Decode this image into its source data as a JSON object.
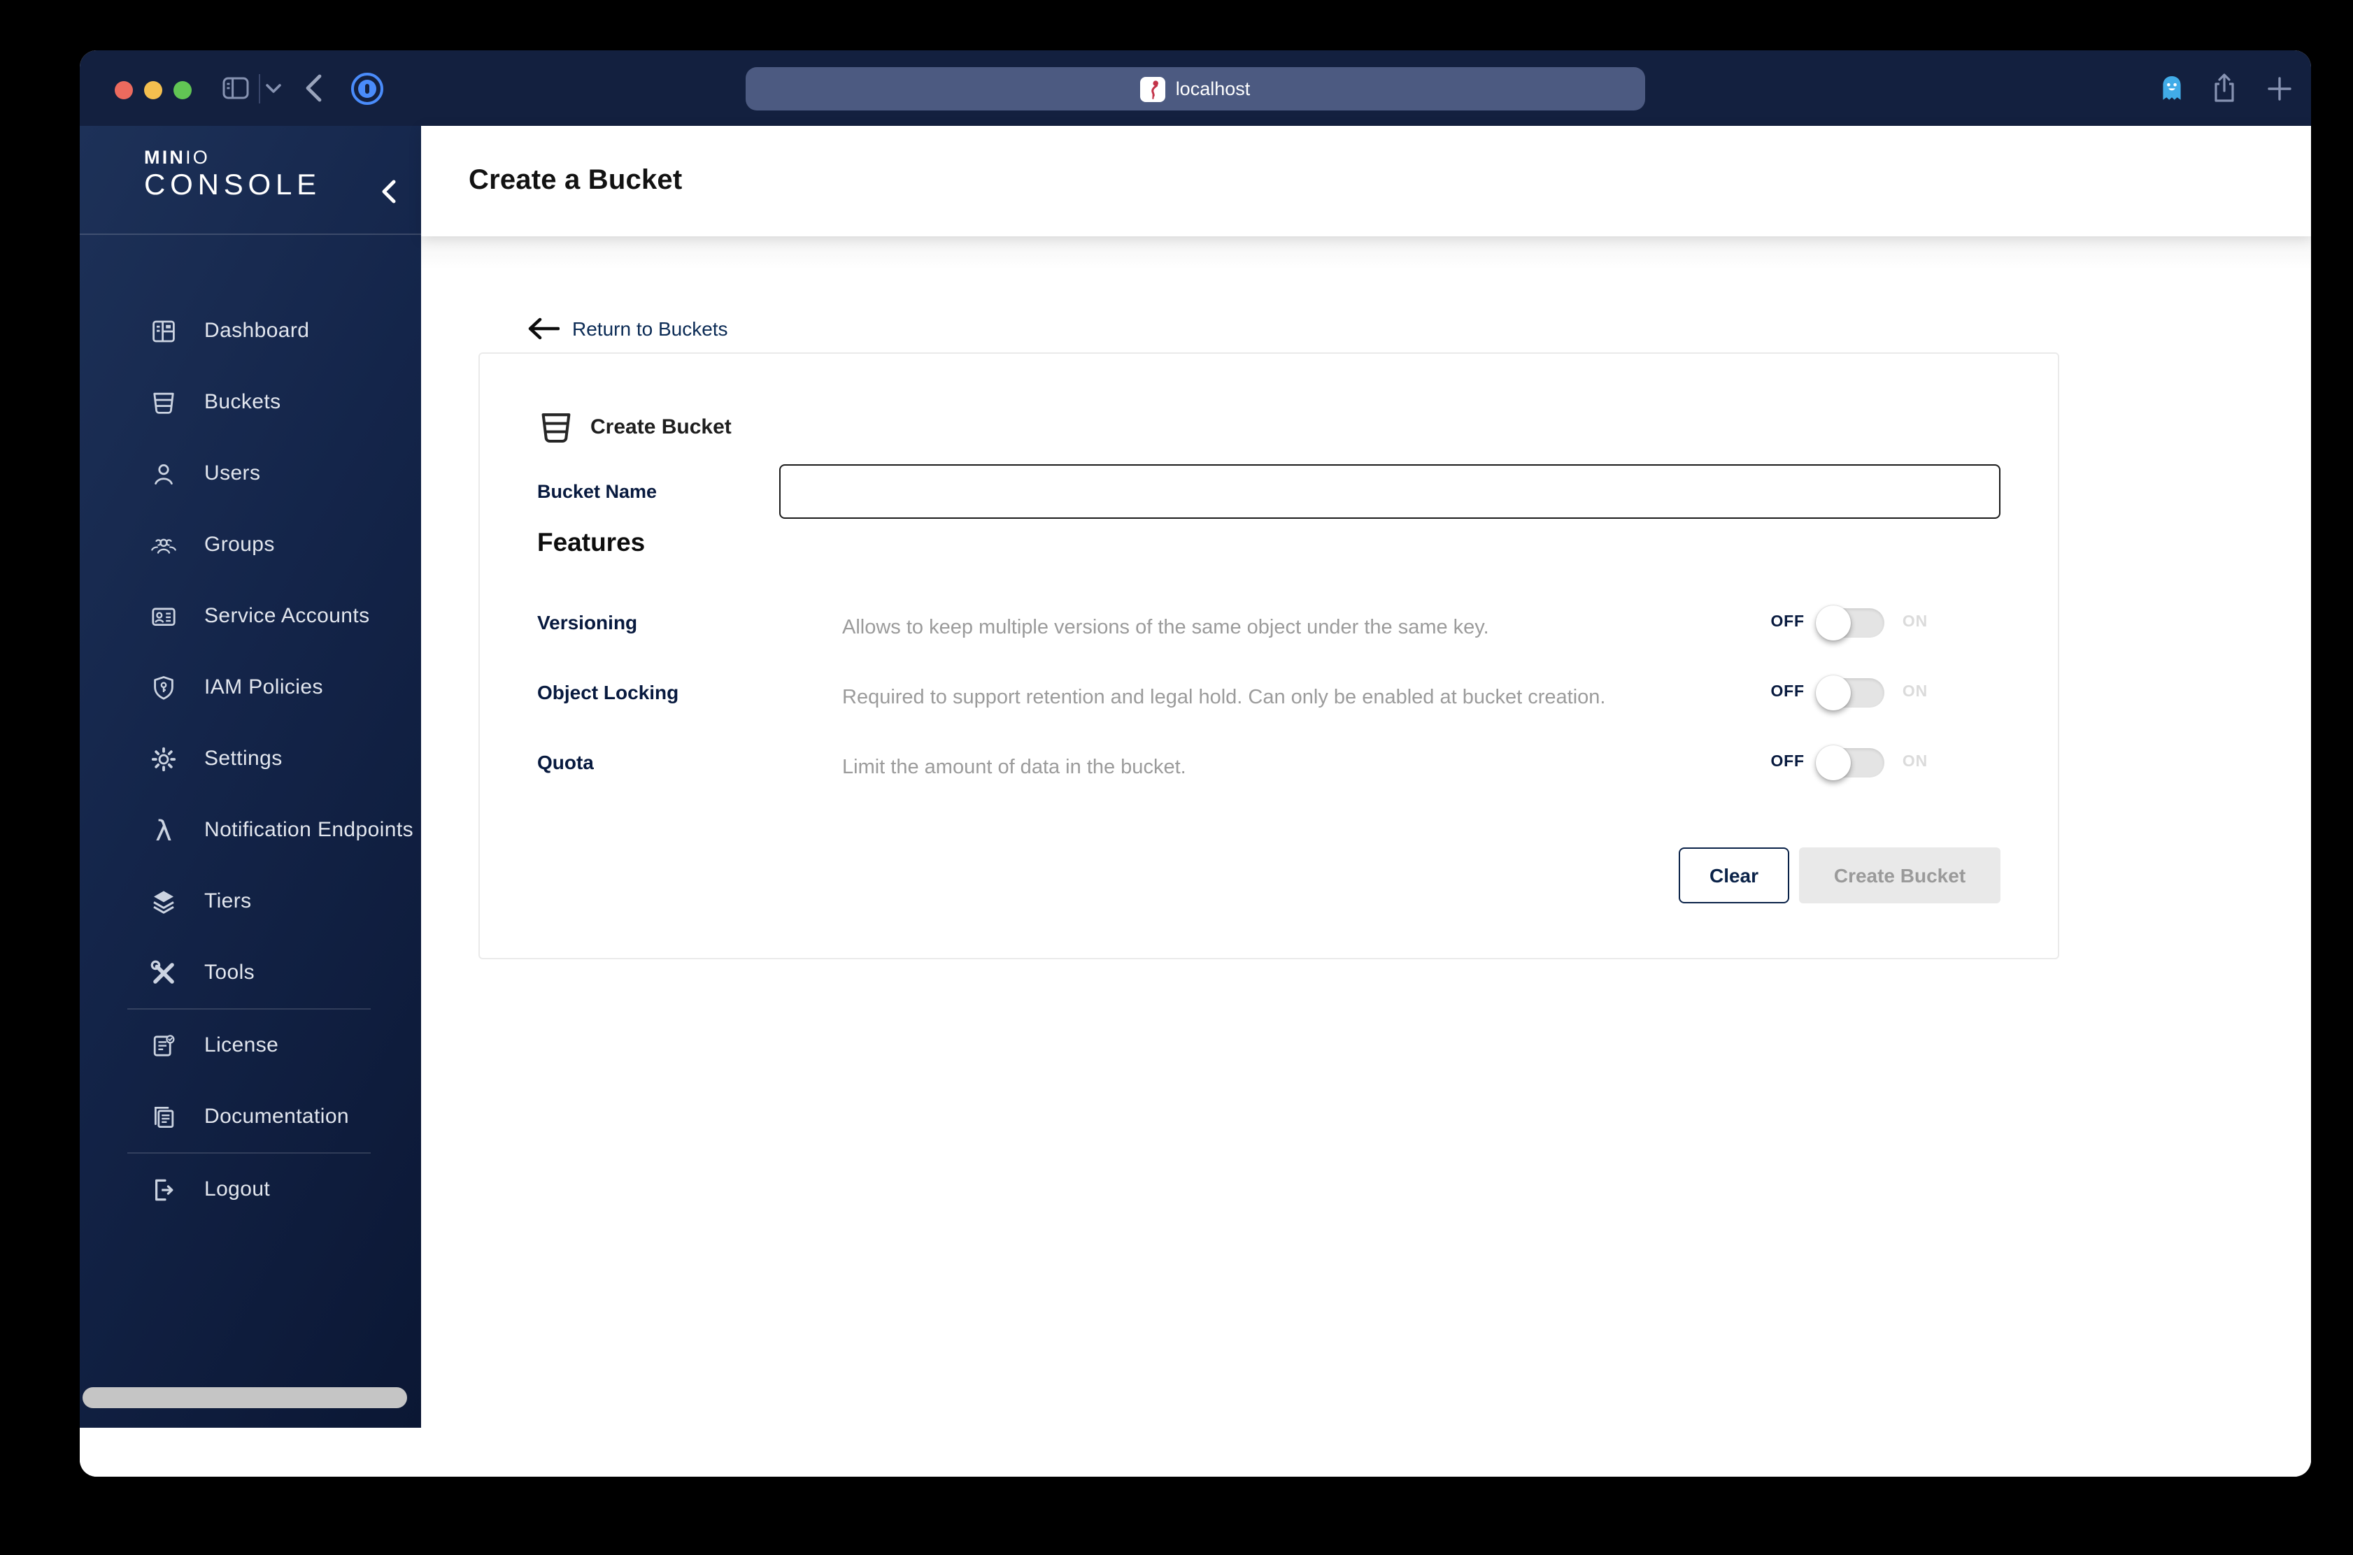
{
  "titlebar": {
    "url": "localhost"
  },
  "sidebar": {
    "logo": {
      "bold": "MIN",
      "light": "IO",
      "word": "CONSOLE"
    },
    "items": [
      {
        "label": "Dashboard",
        "icon": "dashboard-icon"
      },
      {
        "label": "Buckets",
        "icon": "bucket-icon"
      },
      {
        "label": "Users",
        "icon": "user-icon"
      },
      {
        "label": "Groups",
        "icon": "groups-icon"
      },
      {
        "label": "Service Accounts",
        "icon": "id-card-icon"
      },
      {
        "label": "IAM Policies",
        "icon": "shield-key-icon"
      },
      {
        "label": "Settings",
        "icon": "gear-icon"
      },
      {
        "label": "Notification Endpoints",
        "icon": "lambda-icon"
      },
      {
        "label": "Tiers",
        "icon": "layers-icon"
      },
      {
        "label": "Tools",
        "icon": "tools-icon"
      },
      {
        "label": "License",
        "icon": "license-icon"
      },
      {
        "label": "Documentation",
        "icon": "documentation-icon"
      },
      {
        "label": "Logout",
        "icon": "logout-icon"
      }
    ]
  },
  "page": {
    "title": "Create a Bucket",
    "return_link": "Return to Buckets"
  },
  "form": {
    "title": "Create Bucket",
    "bucket_name": {
      "label": "Bucket Name",
      "value": ""
    },
    "features_title": "Features",
    "rows": [
      {
        "label": "Versioning",
        "description": "Allows to keep multiple versions of the same object under the same key."
      },
      {
        "label": "Object Locking",
        "description": "Required to support retention and legal hold. Can only be enabled at bucket creation."
      },
      {
        "label": "Quota",
        "description": "Limit the amount of data in the bucket."
      }
    ],
    "toggle": {
      "off": "OFF",
      "on": "ON",
      "state": "off"
    },
    "buttons": {
      "clear": "Clear",
      "create": "Create Bucket",
      "create_disabled": true
    }
  },
  "colors": {
    "titlebar": "#13203F",
    "sidebar_gradient_start": "#1D3158",
    "sidebar_gradient_end": "#0B1734",
    "urlbar": "#4C5A81",
    "accent_navy": "#07193E",
    "link_text": "#0B2B55",
    "description_gray": "#9B9B9B",
    "toggle_track": "#E4E4E4",
    "disabled_button_bg": "#E9E9E9",
    "disabled_button_text": "#9A9A9A",
    "traffic_red": "#EC6A5E",
    "traffic_yellow": "#F4BF4F",
    "traffic_green": "#61C554",
    "onepassword_blue": "#4A8CFB",
    "ghostery_blue": "#41ACE8",
    "favicon_red": "#C33349"
  }
}
